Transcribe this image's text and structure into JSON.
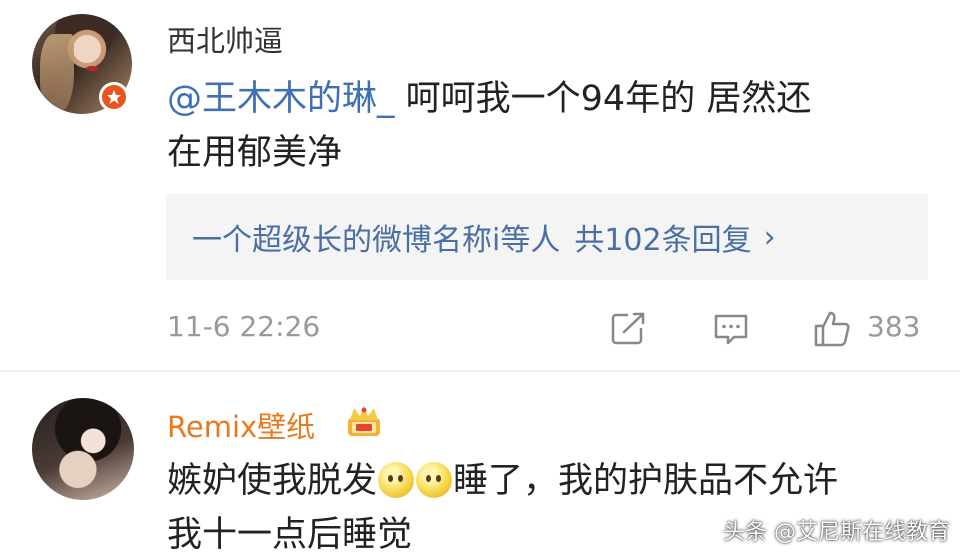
{
  "colors": {
    "mention": "#3f6fb6",
    "vip_name": "#e8791c",
    "reply_link": "#4a6fa5",
    "meta_gray": "#999999"
  },
  "comments": [
    {
      "username": "西北帅逼",
      "avatar_badge_icon": "verified-badge-icon",
      "mention": "@王木木的琳_",
      "text_line1_rest": "呵呵我一个94年的 居然还",
      "text_line2": "在用郁美净",
      "replies_summary": {
        "name": "一个超级长的微博名称i等人",
        "count_text": "共102条回复",
        "chevron": "›"
      },
      "timestamp": "11-6 22:26",
      "like_count": "383"
    },
    {
      "username": "Remix壁纸",
      "name_badge_icon": "crown-icon",
      "text_line1_before_emoji": "嫉妒使我脱发",
      "emoji_icon": "thinking-emoji-icon",
      "text_line1_after_emoji": "睡了，我的护肤品不允许",
      "text_line2": "我十一点后睡觉"
    }
  ],
  "watermark": "头条 @艾尼斯在线教育"
}
